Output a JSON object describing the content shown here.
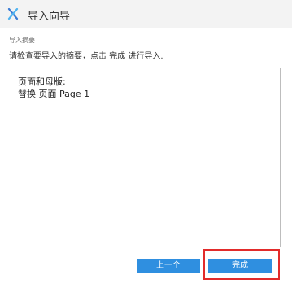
{
  "window": {
    "title": "导入向导",
    "app_icon": "x-logo-icon"
  },
  "summary": {
    "label": "导入摘要",
    "description": "请检查要导入的摘要，点击 完成 进行导入.",
    "lines": [
      "页面和母版:",
      "替换 页面 Page 1"
    ]
  },
  "buttons": {
    "prev_label": "上一个",
    "finish_label": "完成"
  },
  "colors": {
    "button_bg": "#2f8fe0",
    "highlight_border": "#e22b2b",
    "titlebar_bg": "#f3f3f3"
  }
}
